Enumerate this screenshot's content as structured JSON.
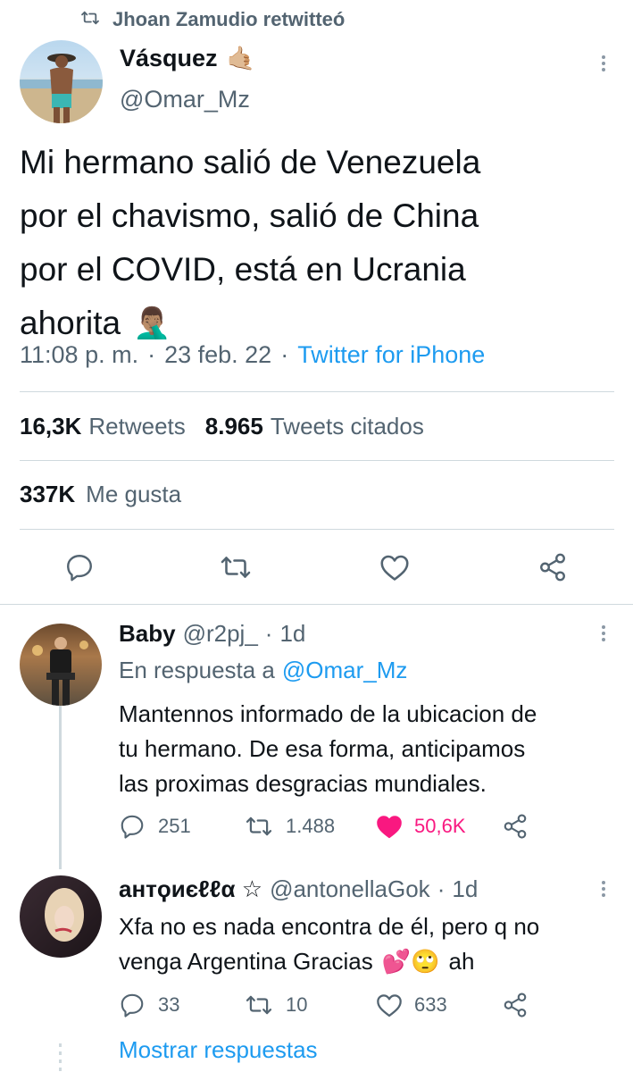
{
  "retweet_banner": {
    "text": "Jhoan Zamudio retwitteó"
  },
  "tweet": {
    "author_name": "Vásquez",
    "author_emoji": "🤙🏼",
    "author_handle": "@Omar_Mz",
    "text_lines": [
      "Mi hermano salió de Venezuela",
      "por el chavismo, salió de China",
      "por el COVID, está en Ucrania",
      "ahorita"
    ],
    "text_emoji": "🤦🏽‍♂️",
    "time": "11:08 p. m.",
    "sep": "·",
    "date": "23 feb. 22",
    "source": "Twitter for iPhone",
    "stats": {
      "retweets_count": "16,3K",
      "retweets_label": "Retweets",
      "quotes_count": "8.965",
      "quotes_label": "Tweets citados",
      "likes_count": "337K",
      "likes_label": "Me gusta"
    }
  },
  "replies": [
    {
      "name": "Baby",
      "handle": "@r2pj_",
      "sep": "·",
      "time": "1d",
      "reply_to_prefix": "En respuesta a",
      "reply_to_handle": "@Omar_Mz",
      "text_lines": [
        "Mantennos informado de la ubicacion de",
        "tu hermano. De esa forma, anticipamos",
        "las proximas desgracias mundiales."
      ],
      "replies_count": "251",
      "retweets_count": "1.488",
      "likes_count": "50,6K",
      "liked": true
    },
    {
      "name": "антϙиєℓℓα ☆",
      "handle": "@antonellaGok",
      "sep": "·",
      "time": "1d",
      "text_line1": "Xfa no es nada encontra de él, pero q no",
      "text_line2_prefix": "venga Argentina Gracias",
      "text_line2_emojis": "💕🙄",
      "text_line2_suffix": "ah",
      "replies_count": "33",
      "retweets_count": "10",
      "likes_count": "633",
      "liked": false
    }
  ],
  "show_replies_label": "Mostrar respuestas",
  "colors": {
    "accent": "#1d9bf0",
    "like": "#f91880",
    "muted": "#536471",
    "divider": "#cfd9de"
  },
  "icons": [
    "retweet-icon",
    "reply-icon",
    "like-icon",
    "share-icon",
    "more-icon"
  ]
}
